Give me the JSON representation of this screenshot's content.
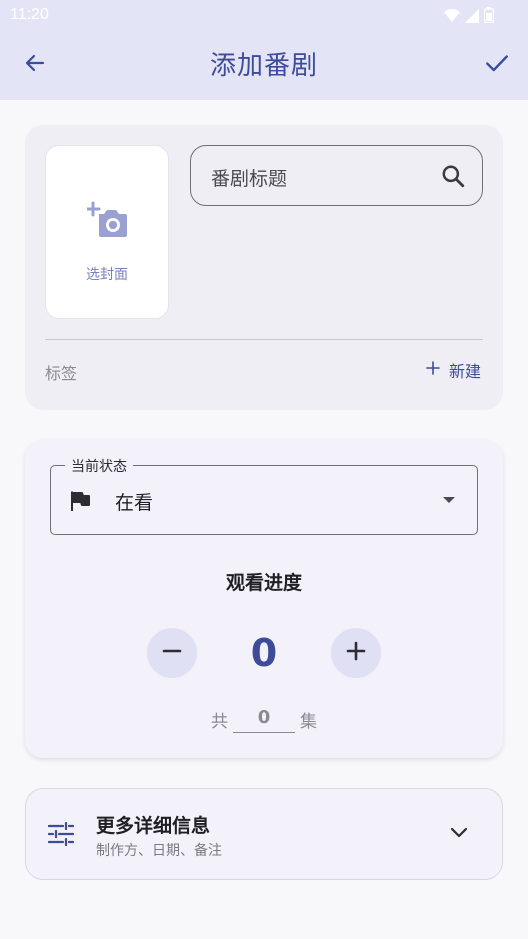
{
  "status_bar": {
    "time": "11:20"
  },
  "appbar": {
    "title": "添加番剧"
  },
  "cover": {
    "label": "选封面"
  },
  "title_field": {
    "placeholder": "番剧标题"
  },
  "tags": {
    "label": "标签",
    "new_label": "新建"
  },
  "status_field": {
    "legend": "当前状态",
    "value": "在看"
  },
  "progress": {
    "title": "观看进度",
    "count": "0",
    "total_prefix": "共",
    "total_value": "0",
    "total_suffix": "集"
  },
  "more_info": {
    "title": "更多详细信息",
    "subtitle": "制作方、日期、备注"
  },
  "colors": {
    "accent": "#3d4b9a",
    "appbar_bg": "#e3e5f6",
    "card_bg": "#eeeef4",
    "button_bg": "#dfe0f3"
  }
}
